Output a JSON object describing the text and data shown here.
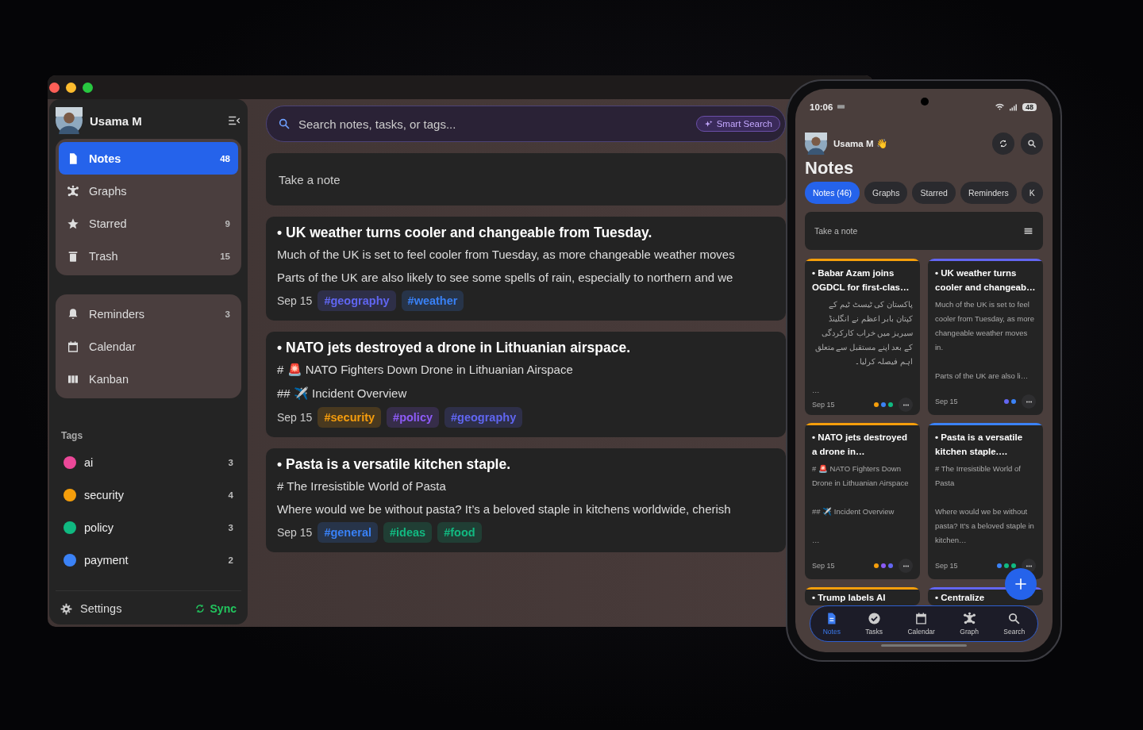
{
  "sidebar": {
    "user": {
      "name": "Usama M"
    },
    "groups": [
      {
        "items": [
          {
            "label": "Notes",
            "count": "48",
            "selected": true
          },
          {
            "label": "Graphs",
            "selected": false
          },
          {
            "label": "Starred",
            "count": "9",
            "selected": false
          },
          {
            "label": "Trash",
            "count": "15",
            "selected": false
          }
        ]
      },
      {
        "items": [
          {
            "label": "Reminders",
            "count": "3",
            "selected": false
          },
          {
            "label": "Calendar",
            "selected": false
          },
          {
            "label": "Kanban",
            "selected": false
          }
        ]
      }
    ],
    "tags": {
      "heading": "Tags",
      "items": [
        {
          "name": "ai",
          "count": "3",
          "color": "#ec4899"
        },
        {
          "name": "security",
          "count": "4",
          "color": "#f59e0b"
        },
        {
          "name": "policy",
          "count": "3",
          "color": "#10b981"
        },
        {
          "name": "payment",
          "count": "2",
          "color": "#3b82f6"
        }
      ]
    },
    "footer": {
      "settings": "Settings",
      "sync": "Sync"
    }
  },
  "search": {
    "placeholder": "Search notes, tasks, or tags...",
    "smart_search": "Smart Search"
  },
  "composer": {
    "placeholder": "Take a note"
  },
  "notes": [
    {
      "title": "• UK weather turns cooler and changeable from Tuesday.",
      "body": [
        "Much of the UK is set to feel cooler from Tuesday, as more changeable weather moves",
        "Parts of the UK are also likely to see some spells of rain, especially to northern and we"
      ],
      "date": "Sep 15",
      "tags": [
        {
          "label": "#geography",
          "color": "#2e2f48"
        },
        {
          "label": "#weather",
          "color": "#273449"
        }
      ]
    },
    {
      "title": "• NATO jets destroyed a drone in Lithuanian airspace.",
      "body": [
        "# 🚨 NATO Fighters Down Drone in Lithuanian Airspace",
        "## ✈️ Incident Overview"
      ],
      "date": "Sep 15",
      "tags": [
        {
          "label": "#security",
          "color": "#49391f"
        },
        {
          "label": "#policy",
          "color": "#362d49"
        },
        {
          "label": "#geography",
          "color": "#2e2f48"
        }
      ]
    },
    {
      "title": "• Pasta is a versatile kitchen staple.",
      "body": [
        "# The Irresistible World of Pasta",
        "Where would we be without pasta? It’s a beloved staple in kitchens worldwide, cherish"
      ],
      "date": "Sep 15",
      "tags": [
        {
          "label": "#general",
          "color": "#273449"
        },
        {
          "label": "#ideas",
          "color": "#203e34"
        },
        {
          "label": "#food",
          "color": "#203e34"
        }
      ]
    }
  ],
  "phone": {
    "status": {
      "time": "10:06",
      "battery": "48"
    },
    "greeting": "Usama M 👋",
    "title": "Notes",
    "tabs": [
      {
        "label": "Notes (46)",
        "selected": true
      },
      {
        "label": "Graphs",
        "selected": false
      },
      {
        "label": "Starred",
        "selected": false
      },
      {
        "label": "Reminders",
        "selected": false
      },
      {
        "label": "K",
        "selected": false
      }
    ],
    "composer": {
      "placeholder": "Take a note"
    },
    "cards": [
      {
        "title": "• Babar Azam joins OGDCL for first-clas…",
        "color": "#f59e0b",
        "body": [
          "پاکستان کی ٹیسٹ ٹیم کے کپتان بابر اعظم نے انگلینڈ سیریز میں خراب کارکردگی کے بعد اپنے مستقبل سے متعلق اہم فیصلہ کرلیا۔",
          "…"
        ],
        "date": "Sep 15",
        "dots": [
          {
            "color": "#f59e0b"
          },
          {
            "color": "#3b82f6"
          },
          {
            "color": "#10b981"
          }
        ]
      },
      {
        "title": "• UK weather turns cooler and changeab…",
        "color": "#6366f1",
        "body": [
          "Much of the UK is set to feel cooler from Tuesday, as more changeable weather moves in.",
          "Parts of the UK are also li…"
        ],
        "date": "Sep 15",
        "dots": [
          {
            "color": "#6366f1"
          },
          {
            "color": "#3b82f6"
          }
        ]
      },
      {
        "title": "• NATO jets destroyed a drone in…",
        "color": "#f59e0b",
        "body": [
          "# 🚨 NATO Fighters Down Drone in Lithuanian Airspace",
          "## ✈️ Incident Overview",
          "…"
        ],
        "date": "Sep 15",
        "dots": [
          {
            "color": "#f59e0b"
          },
          {
            "color": "#8b5cf6"
          },
          {
            "color": "#6366f1"
          }
        ]
      },
      {
        "title": "• Pasta is a versatile kitchen staple.…",
        "color": "#3b82f6",
        "body": [
          "# The Irresistible World of Pasta",
          "Where would we be without pasta? It's a beloved staple in kitchen…"
        ],
        "date": "Sep 15",
        "dots": [
          {
            "color": "#3b82f6"
          },
          {
            "color": "#10b981"
          },
          {
            "color": "#10b981"
          }
        ]
      },
      {
        "title": "• Trump labels AI",
        "color": "#f59e0b"
      },
      {
        "title": "• Centralize",
        "color": "#6366f1"
      }
    ],
    "nav": [
      {
        "label": "Notes",
        "selected": true
      },
      {
        "label": "Tasks",
        "selected": false
      },
      {
        "label": "Calendar",
        "selected": false
      },
      {
        "label": "Graph",
        "selected": false
      },
      {
        "label": "Search",
        "selected": false
      }
    ]
  }
}
